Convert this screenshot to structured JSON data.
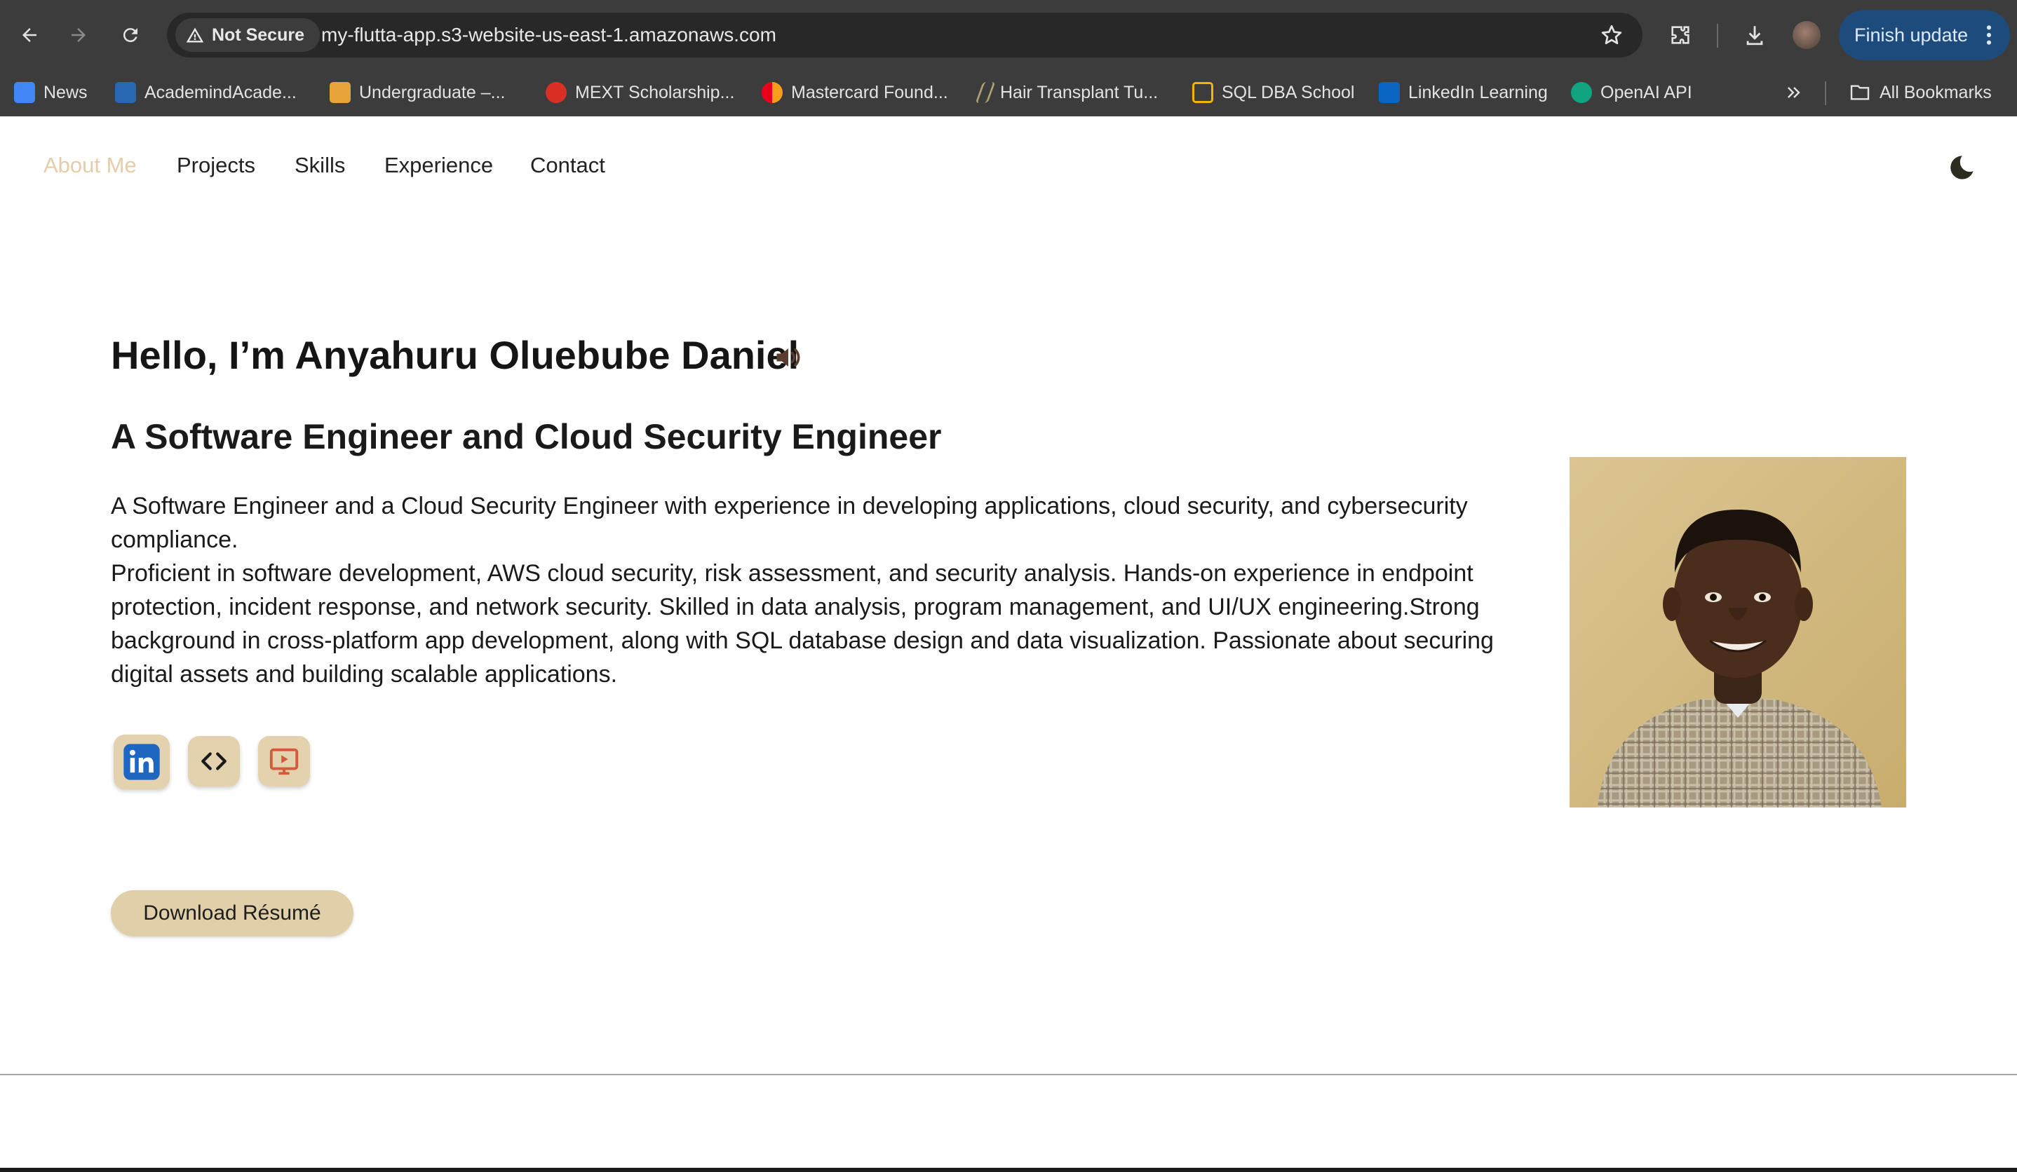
{
  "browser": {
    "security_label": "Not Secure",
    "url": "my-flutta-app.s3-website-us-east-1.amazonaws.com",
    "finish_update_label": "Finish update",
    "bookmarks": [
      {
        "label": "News",
        "color": "#4285f4"
      },
      {
        "label": "AcademindAcade...",
        "color": "#2867b2"
      },
      {
        "label": "Undergraduate –...",
        "color": "#e8a33b"
      },
      {
        "label": "MEXT Scholarship...",
        "color": "#d93025"
      },
      {
        "label": "Mastercard Found...",
        "color": "#f79e1b"
      },
      {
        "label": "Hair Transplant Tu...",
        "color": "#b0a070"
      },
      {
        "label": "SQL DBA School",
        "color": "#f2b600"
      },
      {
        "label": "LinkedIn Learning",
        "color": "#0a66c2"
      },
      {
        "label": "OpenAI API",
        "color": "#10a37f"
      }
    ],
    "all_bookmarks_label": "All Bookmarks"
  },
  "nav": {
    "items": [
      "About Me",
      "Projects",
      "Skills",
      "Experience",
      "Contact"
    ],
    "active": "About Me"
  },
  "hero": {
    "title": "Hello, I’m Anyahuru Oluebube Daniel",
    "subtitle": "A Software Engineer and Cloud Security Engineer",
    "paragraph1": "A Software Engineer and a Cloud Security Engineer with experience in developing applications, cloud security, and cybersecurity compliance.",
    "paragraph2": "Proficient in software development, AWS cloud security, risk assessment, and security analysis. Hands-on experience in endpoint protection, incident response, and network security. Skilled in data analysis, program management, and UI/UX engineering.Strong background in cross-platform app development, along with SQL database design and data visualization. Passionate about securing digital assets and building scalable applications.",
    "resume_button": "Download Résumé"
  },
  "icons": {
    "social": [
      "linkedin-icon",
      "code-icon",
      "video-presentation-icon"
    ]
  },
  "colors": {
    "accent": "#e0cfa8",
    "nav_active": "#e6ccaa",
    "toolbar": "#3c3c3c",
    "update_button": "#1d4c7c"
  }
}
